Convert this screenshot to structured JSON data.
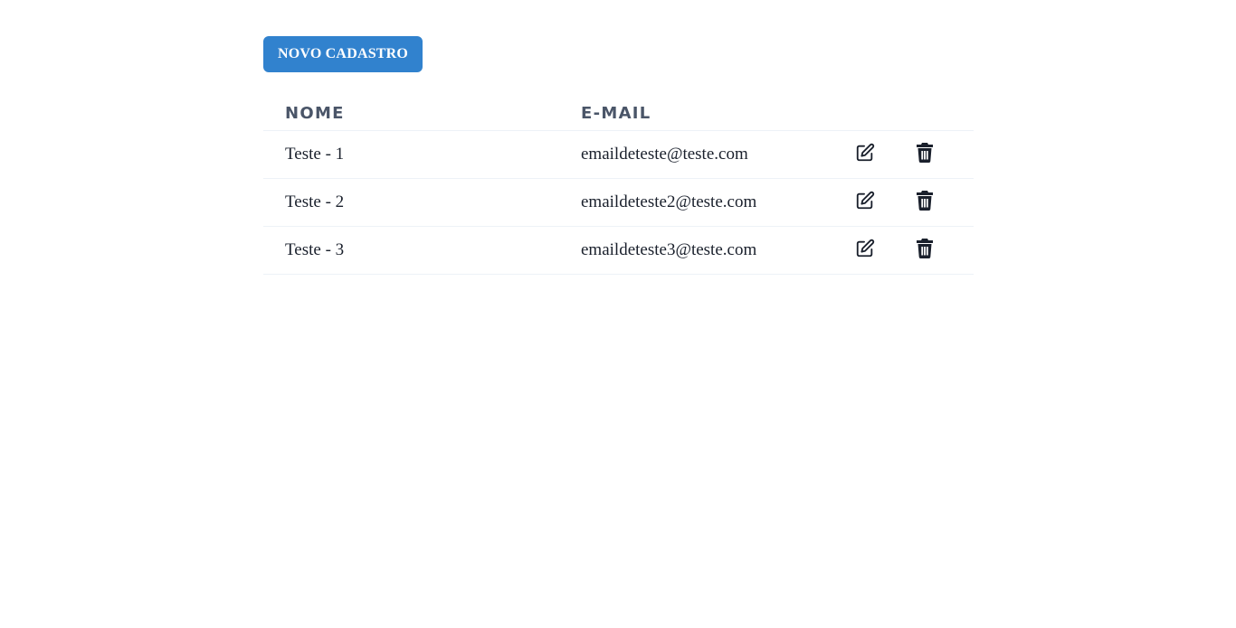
{
  "toolbar": {
    "new_button_label": "NOVO CADASTRO"
  },
  "table": {
    "headers": {
      "name": "NOME",
      "email": "E-MAIL"
    },
    "rows": [
      {
        "name": "Teste - 1",
        "email": "emaildeteste@teste.com",
        "edit_icon": "edit-icon",
        "delete_icon": "trash-icon"
      },
      {
        "name": "Teste - 2",
        "email": "emaildeteste2@teste.com",
        "edit_icon": "edit-icon",
        "delete_icon": "trash-icon"
      },
      {
        "name": "Teste - 3",
        "email": "emaildeteste3@teste.com",
        "edit_icon": "edit-icon",
        "delete_icon": "trash-icon"
      }
    ]
  },
  "colors": {
    "accent": "#3182ce",
    "header_text": "#4a5568",
    "body_text": "#1a202c",
    "divider": "#edf2f7"
  }
}
